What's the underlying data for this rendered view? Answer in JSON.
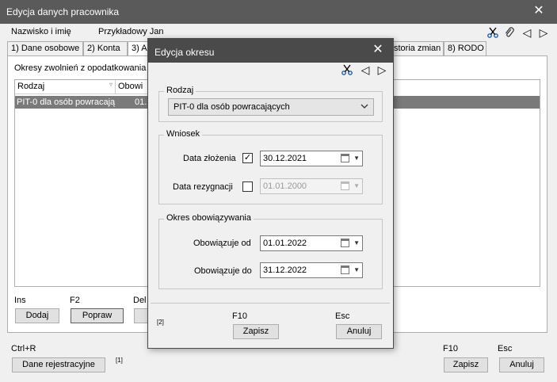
{
  "main": {
    "title": "Edycja danych pracownika",
    "name_label": "Nazwisko i imię",
    "name_value": "Przykładowy Jan",
    "tabs": [
      "1) Dane osobowe",
      "2) Konta",
      "3) A",
      "storia zmian",
      "8) RODO"
    ],
    "section_label": "Okresy zwolnień z opodatkowania",
    "table": {
      "headers": [
        "Rodzaj",
        "Obowi"
      ],
      "rows": [
        [
          "PIT-0 dla osób powracają",
          "01."
        ]
      ]
    },
    "shortcuts": {
      "ins": "Ins",
      "f2": "F2",
      "del": "Del",
      "ctrl_r": "Ctrl+R",
      "f10": "F10",
      "esc": "Esc"
    },
    "buttons": {
      "add": "Dodaj",
      "edit": "Popraw",
      "registration": "Dane rejestracyjne",
      "save": "Zapisz",
      "cancel": "Anuluj"
    },
    "footnote": "[1]"
  },
  "dialog": {
    "title": "Edycja okresu",
    "rodzaj_legend": "Rodzaj",
    "rodzaj_value": "PIT-0 dla osób powracających",
    "wniosek_legend": "Wniosek",
    "data_zlozenia_label": "Data złożenia",
    "data_zlozenia_checked": "✓",
    "data_zlozenia_value": "30.12.2021",
    "data_rezygnacji_label": "Data rezygnacji",
    "data_rezygnacji_value": "01.01.2000",
    "okres_legend": "Okres obowiązywania",
    "od_label": "Obowiązuje od",
    "od_value": "01.01.2022",
    "do_label": "Obowiązuje do",
    "do_value": "31.12.2022",
    "footnote": "[2]",
    "f10": "F10",
    "esc": "Esc",
    "save": "Zapisz",
    "cancel": "Anuluj"
  },
  "icons": {
    "close": "✕",
    "scissors": "scissors-icon",
    "paperclip": "paperclip-icon",
    "prev": "◁",
    "next": "▷",
    "dropdown": "▼"
  }
}
